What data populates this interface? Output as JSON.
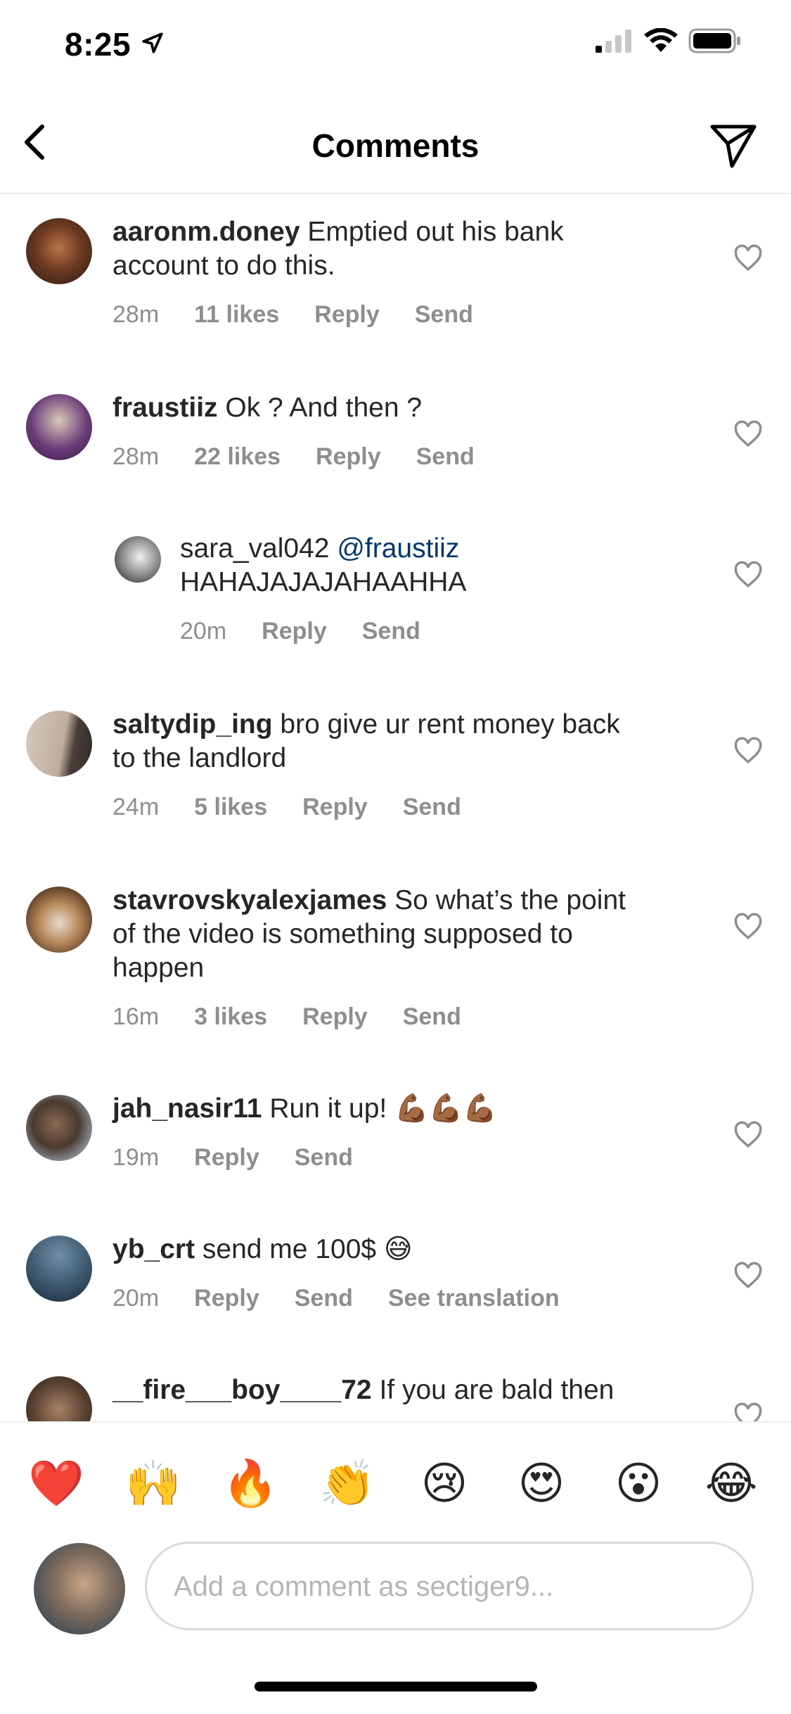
{
  "status": {
    "time": "8:25"
  },
  "header": {
    "title": "Comments"
  },
  "comments": [
    {
      "username": "aaronm.doney",
      "text": "Emptied out his bank account to do this.",
      "time": "28m",
      "likes": "11 likes",
      "reply": "Reply",
      "send": "Send"
    },
    {
      "username": "fraustiiz",
      "text": "Ok ? And then ?",
      "time": "28m",
      "likes": "22 likes",
      "reply": "Reply",
      "send": "Send"
    },
    {
      "username": "sara_val042",
      "mention": "@fraustiiz",
      "text": "HAHAJAJAJAHAAHHA",
      "time": "20m",
      "reply": "Reply",
      "send": "Send"
    },
    {
      "username": "saltydip_ing",
      "text": "bro give ur rent money back to the landlord",
      "time": "24m",
      "likes": "5 likes",
      "reply": "Reply",
      "send": "Send"
    },
    {
      "username": "stavrovskyalexjames",
      "text": "So what’s the point of the video is something supposed to happen",
      "time": "16m",
      "likes": "3 likes",
      "reply": "Reply",
      "send": "Send"
    },
    {
      "username": "jah_nasir11",
      "text": "Run it up! 💪🏾💪🏾💪🏾",
      "time": "19m",
      "reply": "Reply",
      "send": "Send"
    },
    {
      "username": "yb_crt",
      "text": "send me 100$ 😅",
      "time": "20m",
      "reply": "Reply",
      "send": "Send",
      "translate": "See translation"
    },
    {
      "username": "__fire___boy____72",
      "text": "If you are bald then"
    }
  ],
  "emojis": [
    "❤️",
    "🙌",
    "🔥",
    "👏",
    "😢",
    "😍",
    "😮",
    "😂"
  ],
  "composer": {
    "placeholder": "Add a comment as sectiger9..."
  }
}
